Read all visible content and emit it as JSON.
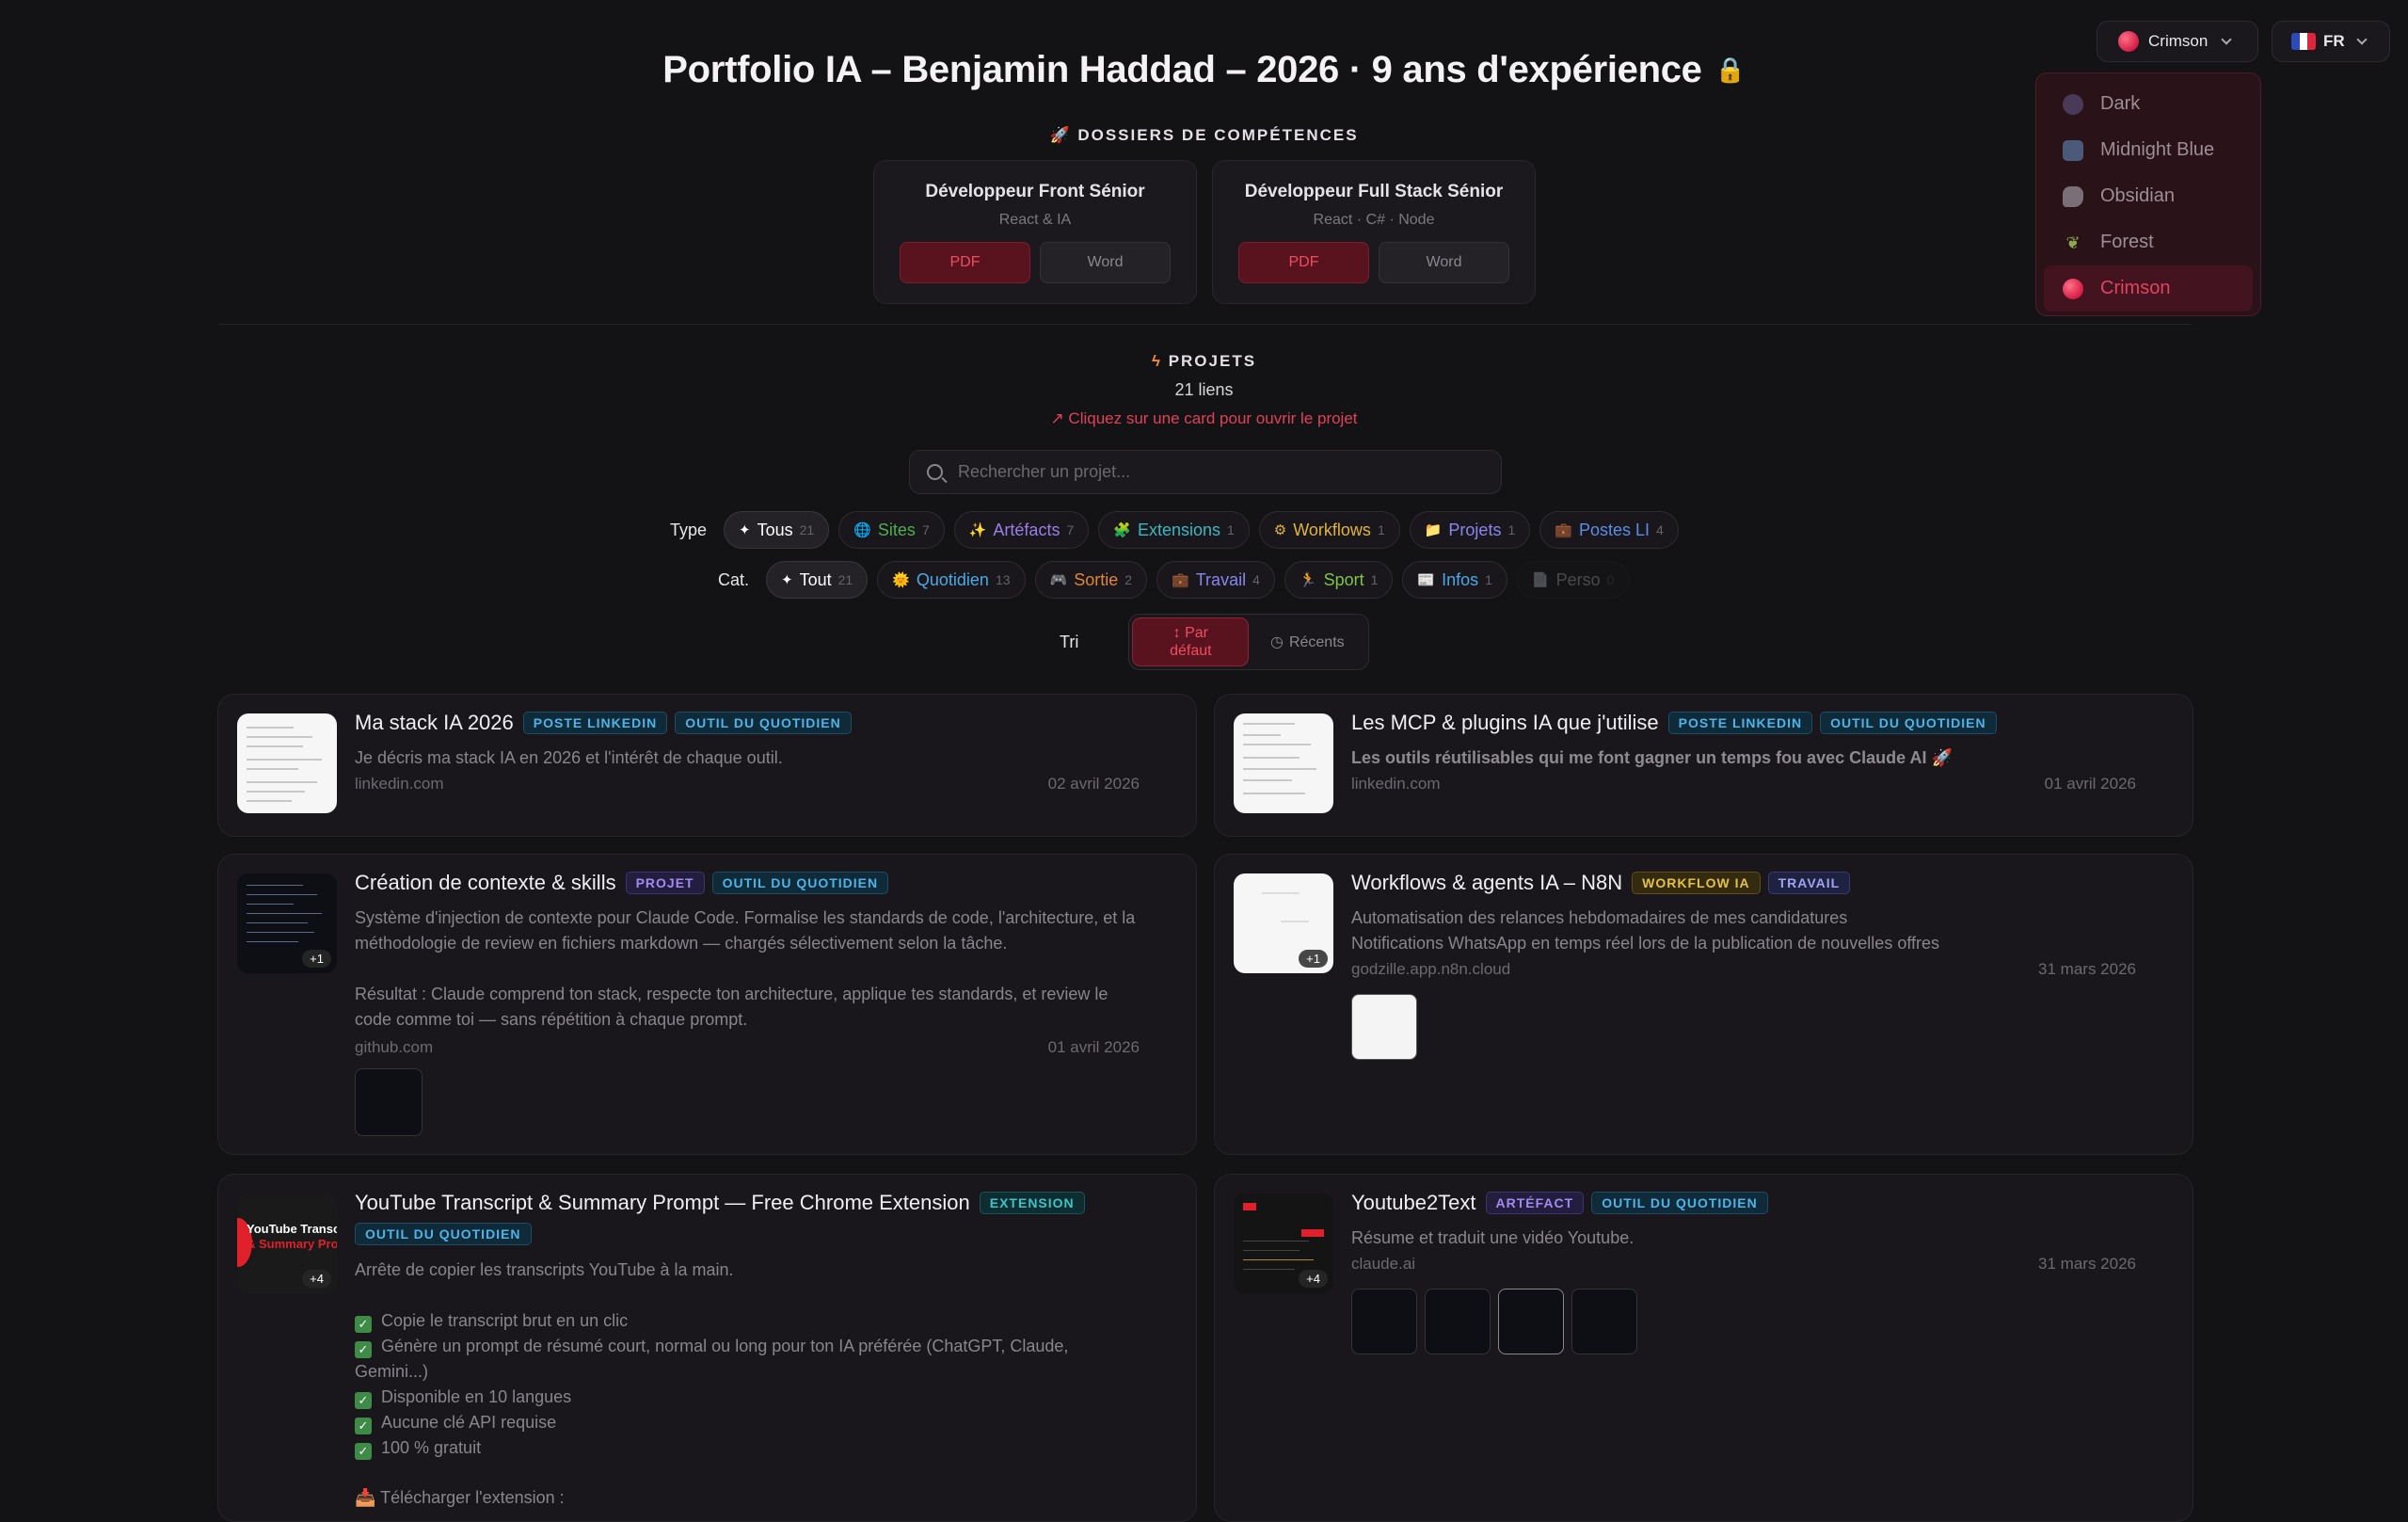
{
  "header": {
    "title": "Portfolio IA – Benjamin Haddad – 2026 · 9 ans d'expérience",
    "theme_current": "Crimson",
    "lang": "FR"
  },
  "theme_menu": {
    "items": [
      {
        "label": "Dark",
        "icon": "dark-dot-icon"
      },
      {
        "label": "Midnight Blue",
        "icon": "moon-icon"
      },
      {
        "label": "Obsidian",
        "icon": "obsidian-icon"
      },
      {
        "label": "Forest",
        "icon": "leaf-icon"
      },
      {
        "label": "Crimson",
        "icon": "crimson-dot-icon",
        "active": true
      }
    ]
  },
  "dossiers": {
    "label": "DOSSIERS DE COMPÉTENCES",
    "cards": [
      {
        "title": "Développeur Front Sénior",
        "subtitle": "React & IA",
        "pdf": "PDF",
        "word": "Word"
      },
      {
        "title": "Développeur Full Stack Sénior",
        "subtitle": "React · C# · Node",
        "pdf": "PDF",
        "word": "Word"
      }
    ]
  },
  "projects": {
    "label": "PROJETS",
    "count": "21 liens",
    "hint": "↗ Cliquez sur une card pour ouvrir le projet",
    "search_placeholder": "Rechercher un projet..."
  },
  "filters": {
    "type_label": "Type",
    "type": [
      {
        "icon": "✦",
        "label": "Tous",
        "count": "21"
      },
      {
        "icon": "🌐",
        "label": "Sites",
        "count": "7"
      },
      {
        "icon": "✨",
        "label": "Artéfacts",
        "count": "7"
      },
      {
        "icon": "🧩",
        "label": "Extensions",
        "count": "1"
      },
      {
        "icon": "⚙",
        "label": "Workflows",
        "count": "1"
      },
      {
        "icon": "📁",
        "label": "Projets",
        "count": "1"
      },
      {
        "icon": "💼",
        "label": "Postes LI",
        "count": "4"
      }
    ],
    "cat_label": "Cat.",
    "cat": [
      {
        "icon": "✦",
        "label": "Tout",
        "count": "21"
      },
      {
        "icon": "🌞",
        "label": "Quotidien",
        "count": "13"
      },
      {
        "icon": "🎮",
        "label": "Sortie",
        "count": "2"
      },
      {
        "icon": "💼",
        "label": "Travail",
        "count": "4"
      },
      {
        "icon": "🏃",
        "label": "Sport",
        "count": "1"
      },
      {
        "icon": "📰",
        "label": "Infos",
        "count": "1"
      },
      {
        "icon": "📄",
        "label": "Perso",
        "count": "0"
      }
    ],
    "sort_label": "Tri",
    "sort_default": "↕ Par\ndéfaut",
    "sort_recent": "Récents"
  },
  "cards": [
    {
      "title": "Ma stack IA 2026",
      "tags": [
        "POSTE LINKEDIN",
        "OUTIL DU QUOTIDIEN"
      ],
      "desc": "Je décris ma stack IA en 2026 et l'intérêt de chaque outil.",
      "domain": "linkedin.com",
      "date": "02 avril 2026"
    },
    {
      "title": "Les MCP & plugins IA que j'utilise",
      "tags": [
        "POSTE LINKEDIN",
        "OUTIL DU QUOTIDIEN"
      ],
      "desc": "Les outils réutilisables qui me font gagner un temps fou avec Claude AI 🚀",
      "domain": "linkedin.com",
      "date": "01 avril 2026"
    },
    {
      "title": "Création de contexte & skills",
      "tags": [
        "PROJET",
        "OUTIL DU QUOTIDIEN"
      ],
      "desc1": "Système d'injection de contexte pour Claude Code. Formalise les standards de code, l'architecture, et la méthodologie de review en fichiers markdown — chargés sélectivement selon la tâche.",
      "desc2": "Résultat : Claude comprend ton stack, respecte ton architecture, applique tes standards, et review le code comme toi — sans répétition à chaque prompt.",
      "domain": "github.com",
      "date": "01 avril 2026",
      "badge": "+1"
    },
    {
      "title": "Workflows & agents IA – N8N",
      "tags": [
        "WORKFLOW IA",
        "TRAVAIL"
      ],
      "desc1": "Automatisation des relances hebdomadaires de mes candidatures",
      "desc2": "Notifications WhatsApp en temps réel lors de la publication de nouvelles offres",
      "domain": "godzille.app.n8n.cloud",
      "date": "31 mars 2026",
      "badge": "+1"
    },
    {
      "title": "YouTube Transcript & Summary Prompt — Free Chrome Extension",
      "tags": [
        "EXTENSION",
        "OUTIL DU QUOTIDIEN"
      ],
      "desc": "Arrête de copier les transcripts YouTube à la main.",
      "checks": [
        "Copie le transcript brut en un clic",
        "Génère un prompt de résumé court, normal ou long pour ton IA préférée (ChatGPT, Claude, Gemini...)",
        "Disponible en 10 langues",
        "Aucune clé API requise",
        "100 % gratuit"
      ],
      "download": "Télécharger l'extension :",
      "thumb_text1": "YouTube Transcr",
      "thumb_text2": "& Summary Prom",
      "badge": "+4"
    },
    {
      "title": "Youtube2Text",
      "tags": [
        "ARTÉFACT",
        "OUTIL DU QUOTIDIEN"
      ],
      "desc": "Résume et traduit une vidéo Youtube.",
      "domain": "claude.ai",
      "date": "31 mars 2026",
      "badge": "+4"
    }
  ],
  "colors": {
    "accent": "#e1405a",
    "background": "#131316",
    "card": "#19171b"
  }
}
